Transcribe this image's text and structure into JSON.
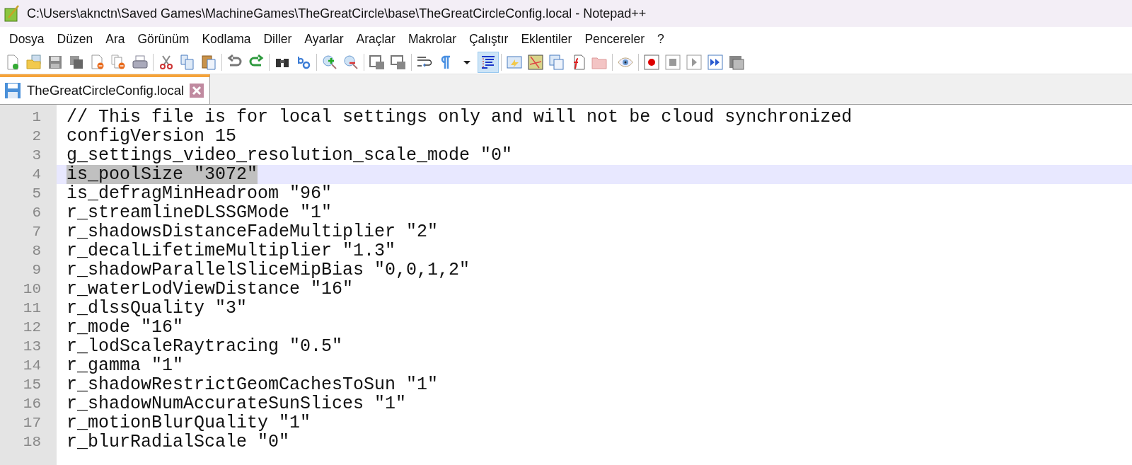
{
  "window": {
    "title": "C:\\Users\\aknctn\\Saved Games\\MachineGames\\TheGreatCircle\\base\\TheGreatCircleConfig.local - Notepad++"
  },
  "menu": [
    "Dosya",
    "Düzen",
    "Ara",
    "Görünüm",
    "Kodlama",
    "Diller",
    "Ayarlar",
    "Araçlar",
    "Makrolar",
    "Çalıştır",
    "Eklentiler",
    "Pencereler",
    "?"
  ],
  "toolbar": [
    {
      "kind": "new",
      "pressed": false
    },
    {
      "kind": "open",
      "pressed": false
    },
    {
      "kind": "save",
      "pressed": false
    },
    {
      "kind": "save-all",
      "pressed": false
    },
    {
      "kind": "close",
      "pressed": false
    },
    {
      "kind": "close-all",
      "pressed": false
    },
    {
      "kind": "print",
      "pressed": false
    },
    {
      "kind": "separator"
    },
    {
      "kind": "cut",
      "pressed": false
    },
    {
      "kind": "copy",
      "pressed": false
    },
    {
      "kind": "paste",
      "pressed": false
    },
    {
      "kind": "separator"
    },
    {
      "kind": "undo",
      "pressed": false
    },
    {
      "kind": "redo",
      "pressed": false
    },
    {
      "kind": "separator"
    },
    {
      "kind": "find",
      "pressed": false
    },
    {
      "kind": "replace",
      "pressed": false
    },
    {
      "kind": "separator"
    },
    {
      "kind": "zoom-in",
      "pressed": false
    },
    {
      "kind": "zoom-out",
      "pressed": false
    },
    {
      "kind": "separator"
    },
    {
      "kind": "sync-v",
      "pressed": false
    },
    {
      "kind": "sync-h",
      "pressed": false
    },
    {
      "kind": "separator"
    },
    {
      "kind": "wrap",
      "pressed": false
    },
    {
      "kind": "pilcrow",
      "pressed": false
    },
    {
      "kind": "dropdown",
      "pressed": false
    },
    {
      "kind": "indent-guide",
      "pressed": true
    },
    {
      "kind": "separator"
    },
    {
      "kind": "lang",
      "pressed": false
    },
    {
      "kind": "doc-map",
      "pressed": false
    },
    {
      "kind": "doc-list",
      "pressed": false
    },
    {
      "kind": "function-list",
      "pressed": false
    },
    {
      "kind": "folder",
      "pressed": false
    },
    {
      "kind": "separator"
    },
    {
      "kind": "monitor",
      "pressed": false
    },
    {
      "kind": "separator"
    },
    {
      "kind": "record",
      "pressed": false
    },
    {
      "kind": "stop",
      "pressed": false
    },
    {
      "kind": "play",
      "pressed": false
    },
    {
      "kind": "play-multi",
      "pressed": false
    },
    {
      "kind": "save-macro",
      "pressed": false
    }
  ],
  "tabs": [
    {
      "label": "TheGreatCircleConfig.local",
      "selected": true
    }
  ],
  "lines": [
    {
      "number": "1",
      "text": "// This file is for local settings only and will not be cloud synchronized",
      "current": false,
      "selected": false
    },
    {
      "number": "2",
      "text": "configVersion 15",
      "current": false,
      "selected": false
    },
    {
      "number": "3",
      "text": "g_settings_video_resolution_scale_mode \"0\"",
      "current": false,
      "selected": false
    },
    {
      "number": "4",
      "text": "is_poolSize \"3072\"",
      "current": true,
      "selected": true
    },
    {
      "number": "5",
      "text": "is_defragMinHeadroom \"96\"",
      "current": false,
      "selected": false
    },
    {
      "number": "6",
      "text": "r_streamlineDLSSGMode \"1\"",
      "current": false,
      "selected": false
    },
    {
      "number": "7",
      "text": "r_shadowsDistanceFadeMultiplier \"2\"",
      "current": false,
      "selected": false
    },
    {
      "number": "8",
      "text": "r_decalLifetimeMultiplier \"1.3\"",
      "current": false,
      "selected": false
    },
    {
      "number": "9",
      "text": "r_shadowParallelSliceMipBias \"0,0,1,2\"",
      "current": false,
      "selected": false
    },
    {
      "number": "10",
      "text": "r_waterLodViewDistance \"16\"",
      "current": false,
      "selected": false
    },
    {
      "number": "11",
      "text": "r_dlssQuality \"3\"",
      "current": false,
      "selected": false
    },
    {
      "number": "12",
      "text": "r_mode \"16\"",
      "current": false,
      "selected": false
    },
    {
      "number": "13",
      "text": "r_lodScaleRaytracing \"0.5\"",
      "current": false,
      "selected": false
    },
    {
      "number": "14",
      "text": "r_gamma \"1\"",
      "current": false,
      "selected": false
    },
    {
      "number": "15",
      "text": "r_shadowRestrictGeomCachesToSun \"1\"",
      "current": false,
      "selected": false
    },
    {
      "number": "16",
      "text": "r_shadowNumAccurateSunSlices \"1\"",
      "current": false,
      "selected": false
    },
    {
      "number": "17",
      "text": "r_motionBlurQuality \"1\"",
      "current": false,
      "selected": false
    },
    {
      "number": "18",
      "text": "r_blurRadialScale \"0\"",
      "current": false,
      "selected": false
    }
  ]
}
